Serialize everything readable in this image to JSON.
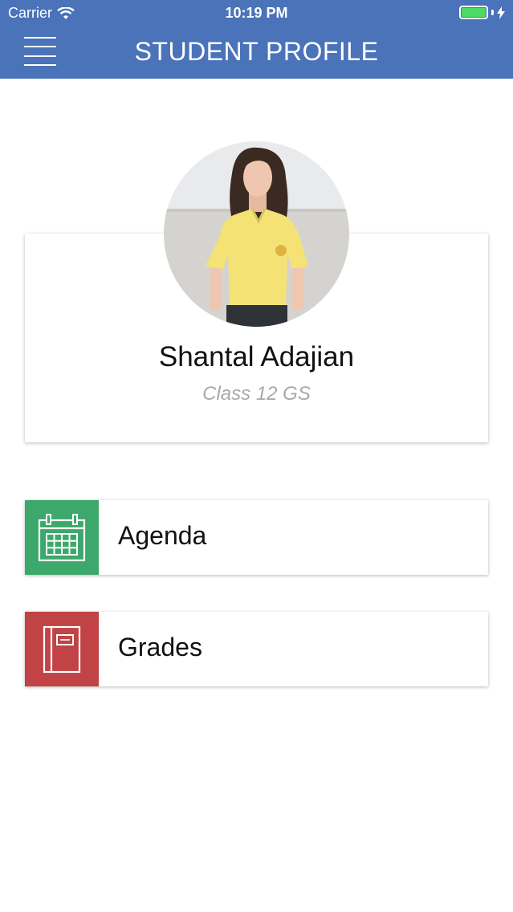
{
  "status_bar": {
    "carrier": "Carrier",
    "time": "10:19 PM",
    "battery_color": "#4cd964"
  },
  "header": {
    "title": "STUDENT PROFILE",
    "background": "#4a73b9",
    "menu_icon": "hamburger-menu-icon"
  },
  "profile": {
    "name": "Shantal Adajian",
    "class": "Class 12 GS",
    "avatar_icon": "student-photo"
  },
  "menu": [
    {
      "label": "Agenda",
      "icon": "calendar-icon",
      "color": "#3da86b"
    },
    {
      "label": "Grades",
      "icon": "notebook-icon",
      "color": "#c14345"
    }
  ]
}
